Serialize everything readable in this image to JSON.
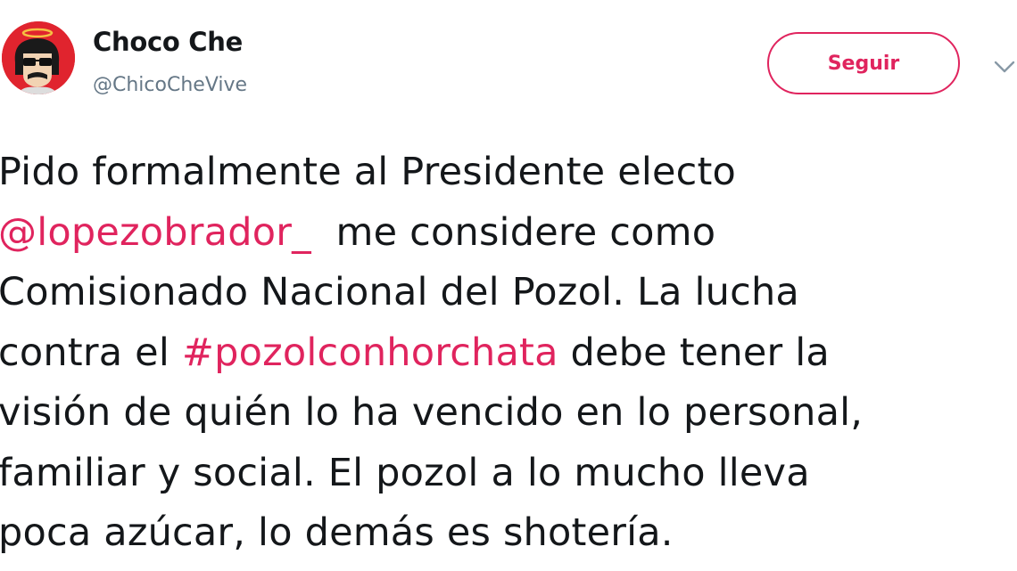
{
  "tweet": {
    "author": {
      "name": "Choco Che",
      "handle": "@ChicoCheVive"
    },
    "follow_label": "Seguir",
    "lines": [
      {
        "before": "Pido formalmente al Presidente electo",
        "link": "",
        "after": ""
      },
      {
        "before": "",
        "link": "@lopezobrador_",
        "after": "  me considere como"
      },
      {
        "before": "Comisionado Nacional del Pozol. La lucha",
        "link": "",
        "after": ""
      },
      {
        "before": "contra el ",
        "link": "#pozolconhorchata",
        "after": " debe tener la"
      },
      {
        "before": "visión de quién lo ha vencido en lo personal,",
        "link": "",
        "after": ""
      },
      {
        "before": "familiar y social. El pozol a lo mucho lleva",
        "link": "",
        "after": ""
      },
      {
        "before": "poca azúcar, lo demás es shotería.",
        "link": "",
        "after": ""
      }
    ]
  },
  "icons": {
    "avatar": "cartoon-avatar-with-halo",
    "caret": "chevron-down-icon"
  },
  "colors": {
    "accent": "#e0245e",
    "avatar_background": "#e0242e",
    "handle": "#657786",
    "text": "#14171a"
  }
}
